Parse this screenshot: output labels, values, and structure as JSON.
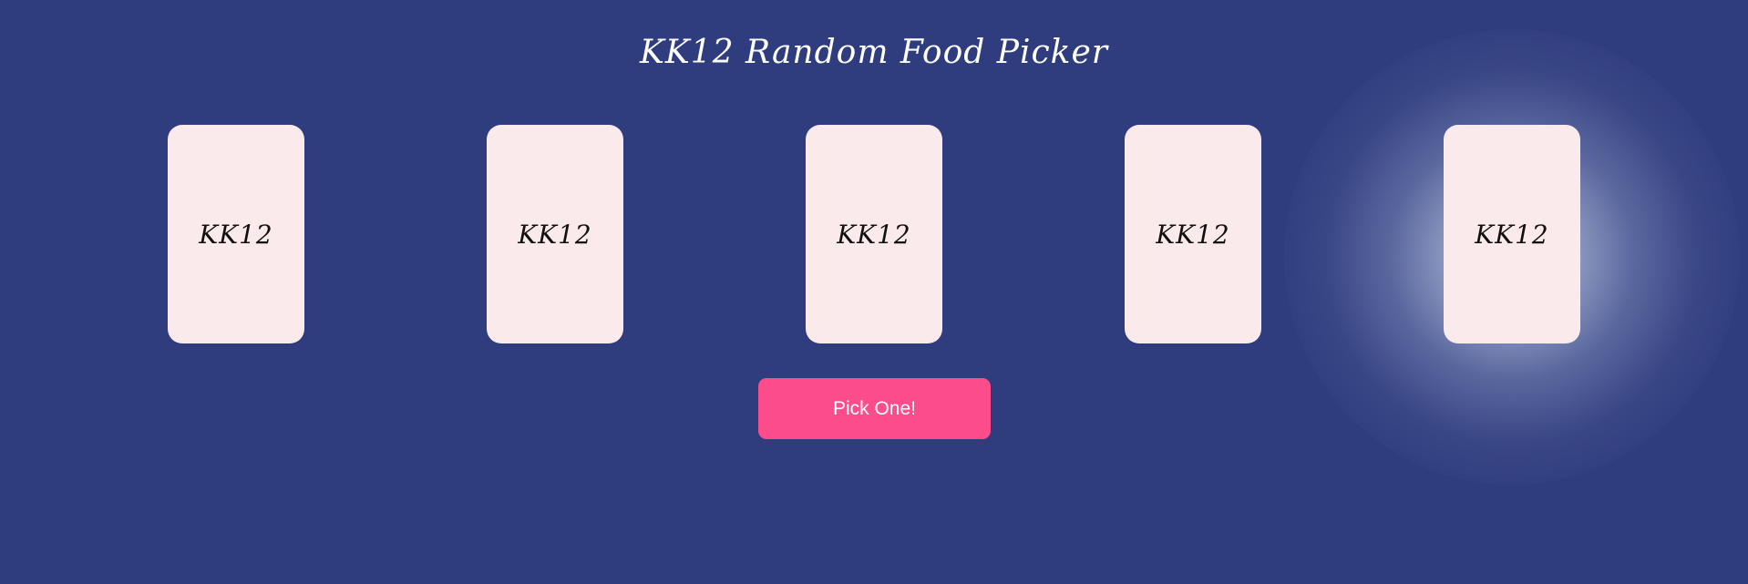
{
  "page": {
    "title": "KK12 Random Food Picker"
  },
  "cards": [
    {
      "label": "KK12"
    },
    {
      "label": "KK12"
    },
    {
      "label": "KK12"
    },
    {
      "label": "KK12"
    },
    {
      "label": "KK12"
    }
  ],
  "actions": {
    "pick_label": "Pick One!"
  },
  "colors": {
    "background": "#2f3c7e",
    "card": "#fbeaeb",
    "button": "#fc4c8c",
    "highlight_glow": "#cdd7e8"
  }
}
